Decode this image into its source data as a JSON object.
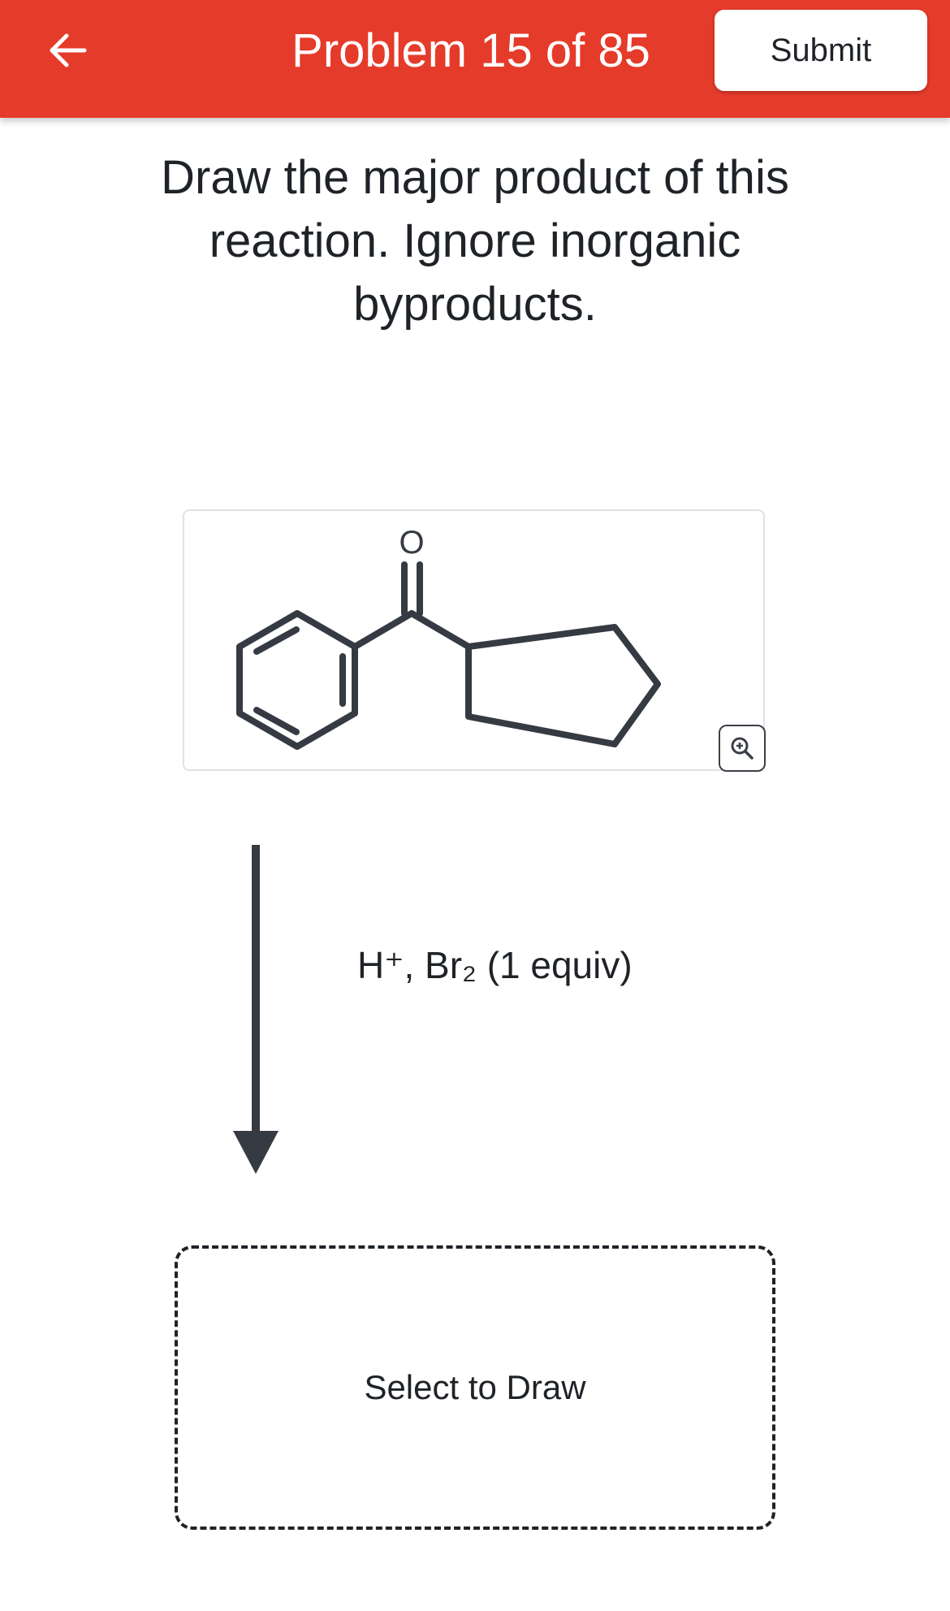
{
  "header": {
    "back_icon": "arrow-left-icon",
    "title": "Problem 15 of 85",
    "submit_label": "Submit",
    "background_color": "#e53b2a"
  },
  "question": {
    "text": "Draw the major product of this reaction. Ignore inorganic byproducts."
  },
  "reactant": {
    "atom_label": "O",
    "zoom_icon": "zoom-in-icon"
  },
  "reaction": {
    "arrow_icon": "arrow-down-icon",
    "reagents": "H⁺, Br₂ (1 equiv)"
  },
  "answer": {
    "draw_label": "Select to Draw"
  }
}
